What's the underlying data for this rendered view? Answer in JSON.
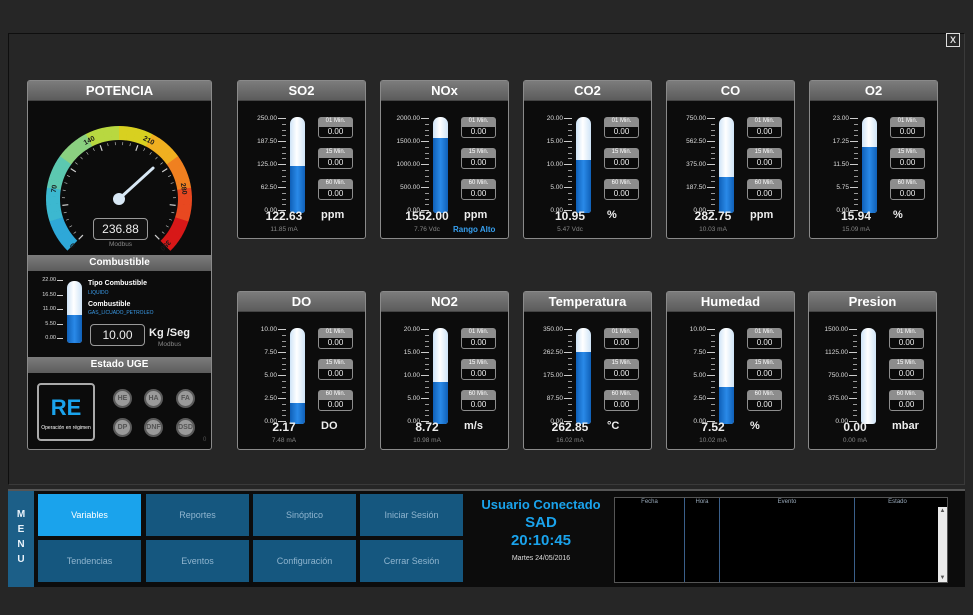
{
  "close": "X",
  "potencia": {
    "title": "POTENCIA",
    "gauge_ticks": [
      "0",
      "70",
      "140",
      "210",
      "280",
      "350"
    ],
    "gauge_max": 350,
    "value": "236.88",
    "value_num": 236.88,
    "source": "Modbus"
  },
  "combustible": {
    "title": "Combustible",
    "ticks": [
      "22.00",
      "16.50",
      "11.00",
      "5.50",
      "0.00"
    ],
    "level": 0.45,
    "tipo_label": "Tipo Combustible",
    "tipo_value": "LIQUIDO",
    "comb_label": "Combustible",
    "comb_value": "GAS_LICUADO_PETROLEO",
    "value": "10.00",
    "unit": "Kg /Seg",
    "source": "Modbus"
  },
  "estado": {
    "title": "Estado UGE",
    "code": "RE",
    "desc": "Operación en régimen",
    "buttons": [
      "HE",
      "HA",
      "FA",
      "DP",
      "DNF",
      "DSD"
    ],
    "corner": "0"
  },
  "averages": [
    "01 Min.",
    "15 Min.",
    "60 Min."
  ],
  "sensors": [
    {
      "title": "SO2",
      "ticks": [
        "250.00",
        "187.50",
        "125.00",
        "62.50",
        "0.00"
      ],
      "level": 0.49,
      "avg": [
        "0.00",
        "0.00",
        "0.00"
      ],
      "value": "122.63",
      "unit": "ppm",
      "sub": "11.85 mA",
      "alert": ""
    },
    {
      "title": "NOx",
      "ticks": [
        "2000.00",
        "1500.00",
        "1000.00",
        "500.00",
        "0.00"
      ],
      "level": 0.78,
      "avg": [
        "0.00",
        "0.00",
        "0.00"
      ],
      "value": "1552.00",
      "unit": "ppm",
      "sub": "7.76 Vdc",
      "alert": "Rango Alto"
    },
    {
      "title": "CO2",
      "ticks": [
        "20.00",
        "15.00",
        "10.00",
        "5.00",
        "0.00"
      ],
      "level": 0.55,
      "avg": [
        "0.00",
        "0.00",
        "0.00"
      ],
      "value": "10.95",
      "unit": "%",
      "sub": "5.47 Vdc",
      "alert": ""
    },
    {
      "title": "CO",
      "ticks": [
        "750.00",
        "562.50",
        "375.00",
        "187.50",
        "0.00"
      ],
      "level": 0.38,
      "avg": [
        "0.00",
        "0.00",
        "0.00"
      ],
      "value": "282.75",
      "unit": "ppm",
      "sub": "10.03 mA",
      "alert": ""
    },
    {
      "title": "O2",
      "ticks": [
        "23.00",
        "17.25",
        "11.50",
        "5.75",
        "0.00"
      ],
      "level": 0.69,
      "avg": [
        "0.00",
        "0.00",
        "0.00"
      ],
      "value": "15.94",
      "unit": "%",
      "sub": "15.09 mA",
      "alert": ""
    },
    {
      "title": "DO",
      "ticks": [
        "10.00",
        "7.50",
        "5.00",
        "2.50",
        "0.00"
      ],
      "level": 0.22,
      "avg": [
        "0.00",
        "0.00",
        "0.00"
      ],
      "value": "2.17",
      "unit": "DO",
      "sub": "7.48 mA",
      "alert": ""
    },
    {
      "title": "NO2",
      "ticks": [
        "20.00",
        "15.00",
        "10.00",
        "5.00",
        "0.00"
      ],
      "level": 0.44,
      "avg": [
        "0.00",
        "0.00",
        "0.00"
      ],
      "value": "8.72",
      "unit": "m/s",
      "sub": "10.98 mA",
      "alert": ""
    },
    {
      "title": "Temperatura",
      "ticks": [
        "350.00",
        "262.50",
        "175.00",
        "87.50",
        "0.00"
      ],
      "level": 0.75,
      "avg": [
        "0.00",
        "0.00",
        "0.00"
      ],
      "value": "262.85",
      "unit": "°C",
      "sub": "16.02 mA",
      "alert": ""
    },
    {
      "title": "Humedad",
      "ticks": [
        "10.00",
        "7.50",
        "5.00",
        "2.50",
        "0.00"
      ],
      "level": 0.39,
      "avg": [
        "0.00",
        "0.00",
        "0.00"
      ],
      "value": "7.52",
      "unit": "%",
      "sub": "10.02 mA",
      "alert": ""
    },
    {
      "title": "Presion",
      "ticks": [
        "1500.00",
        "1125.00",
        "750.00",
        "375.00",
        "0.00"
      ],
      "level": 0.0,
      "avg": [
        "0.00",
        "0.00",
        "0.00"
      ],
      "value": "0.00",
      "unit": "mbar",
      "sub": "0.00 mA",
      "alert": ""
    }
  ],
  "menu": {
    "letters": [
      "M",
      "E",
      "N",
      "U"
    ],
    "buttons": [
      "Variables",
      "Reportes",
      "Sinóptico",
      "Iniciar Sesión",
      "Tendencias",
      "Eventos",
      "Configuración",
      "Cerrar Sesión"
    ]
  },
  "user": {
    "title": "Usuario Conectado",
    "name": "SAD",
    "time": "20:10:45",
    "date": "Martes 24/05/2016"
  },
  "log": {
    "columns": [
      "Fecha",
      "Hora",
      "Evento",
      "Estado"
    ]
  },
  "colors": {
    "accent": "#1aa3ec",
    "menu": "#15577f",
    "bar_fill": "#2a8ae8",
    "alert": "#37a0f0"
  }
}
